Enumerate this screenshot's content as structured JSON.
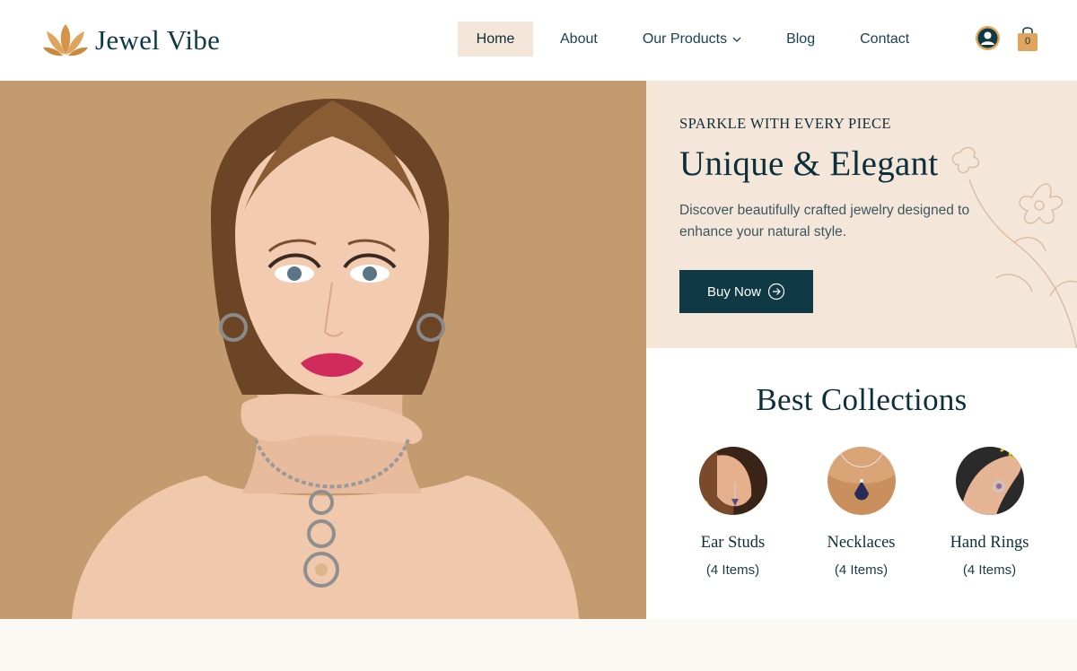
{
  "brand": {
    "name": "Jewel Vibe",
    "accent": "#d4954a",
    "primary": "#0f3a45"
  },
  "nav": {
    "items": [
      {
        "label": "Home",
        "active": true
      },
      {
        "label": "About"
      },
      {
        "label": "Our Products",
        "has_dropdown": true
      },
      {
        "label": "Blog"
      },
      {
        "label": "Contact"
      }
    ]
  },
  "header_actions": {
    "user_icon": "user-circle-icon",
    "cart_icon": "shopping-bag-icon",
    "cart_count": "0"
  },
  "hero": {
    "image_alt": "woman-wearing-jewelry-photo",
    "eyebrow": "SPARKLE WITH EVERY PIECE",
    "title": "Unique & Elegant",
    "description": "Discover beautifully crafted jewelry designed to enhance your natural style.",
    "cta_label": "Buy Now",
    "cta_icon": "arrow-right-circle-icon",
    "promo_bg": "#f4e7da",
    "image_bg": "#c39a6e"
  },
  "collections": {
    "title": "Best Collections",
    "items": [
      {
        "name": "Ear Studs",
        "count": "(4 Items)"
      },
      {
        "name": "Necklaces",
        "count": "(4 Items)"
      },
      {
        "name": "Hand Rings",
        "count": "(4 Items)"
      }
    ]
  }
}
